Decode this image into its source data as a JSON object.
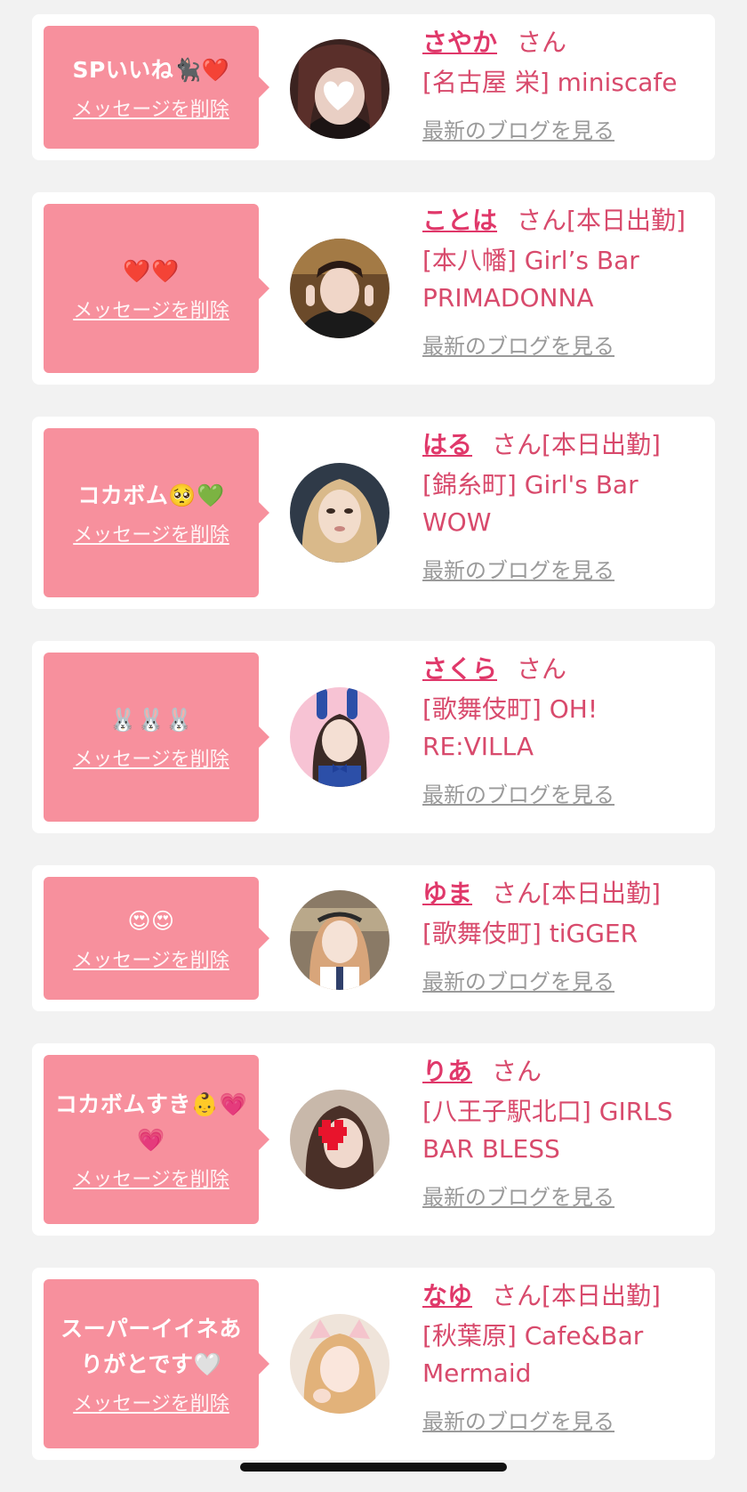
{
  "colors": {
    "page_bg": "#f2f2f2",
    "card_bg": "#ffffff",
    "bubble_bg": "#f7909d",
    "name_color": "#e0386a",
    "shop_color": "#d84a6c",
    "blog_link_color": "#9a9a9a"
  },
  "labels": {
    "delete_message": "メッセージを削除",
    "view_latest_blog": "最新のブログを見る"
  },
  "items": [
    {
      "message": "SPいいね🐈‍⬛❤️",
      "name": "さやか",
      "suffix": "さん",
      "shop": "[名古屋 栄] miniscafe",
      "avatar_icon": "heart-sticker-portrait"
    },
    {
      "message": "❤️❤️",
      "name": "ことは",
      "suffix": "さん[本日出勤]",
      "shop": "[本八幡] Girl’s Bar PRIMADONNA",
      "avatar_icon": "peace-sign-portrait"
    },
    {
      "message": "コカボム🥺💚",
      "name": "はる",
      "suffix": "さん[本日出勤]",
      "shop": "[錦糸町] Girl's Bar WOW",
      "avatar_icon": "blonde-portrait"
    },
    {
      "message": "🐰🐰🐰",
      "name": "さくら",
      "suffix": "さん",
      "shop": "[歌舞伎町] OH! RE:VILLA",
      "avatar_icon": "bunny-costume-portrait"
    },
    {
      "message": "😍😍",
      "name": "ゆま",
      "suffix": "さん[本日出勤]",
      "shop": "[歌舞伎町] tiGGER",
      "avatar_icon": "maid-portrait"
    },
    {
      "message": "コカボムすき👶💗💗",
      "name": "りあ",
      "suffix": "さん",
      "shop": "[八王子駅北口] GIRLS BAR BLESS",
      "avatar_icon": "pixel-heart-portrait"
    },
    {
      "message": "スーパーイイネありがとです🤍",
      "name": "なゆ",
      "suffix": "さん[本日出勤]",
      "shop": "[秋葉原] Cafe&Bar Mermaid",
      "avatar_icon": "cat-ears-portrait"
    }
  ]
}
